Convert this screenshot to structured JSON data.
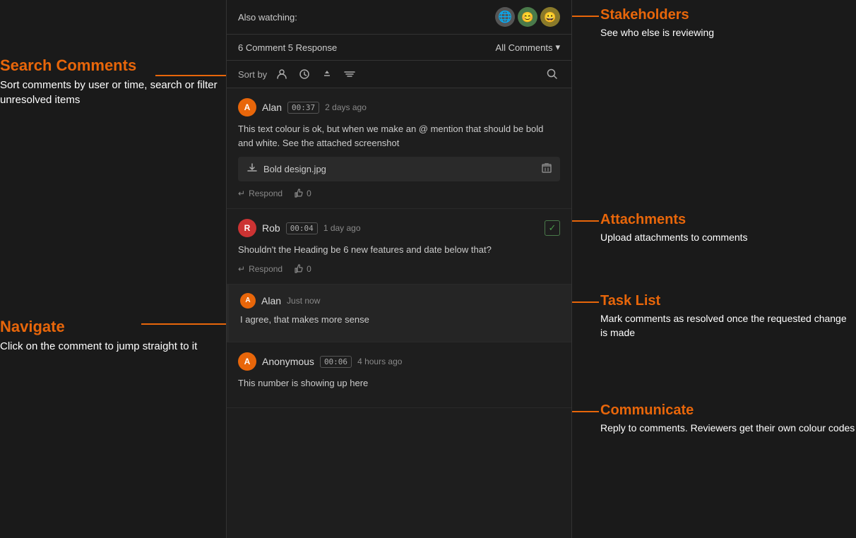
{
  "header": {
    "also_watching_label": "Also watching:",
    "comment_count_label": "6 Comment 5 Response",
    "filter_label": "All Comments",
    "sort_label": "Sort by"
  },
  "left_annotations": {
    "search_title": "Search Comments",
    "search_desc": "Sort comments by user or time, search or filter unresolved items",
    "navigate_title": "Navigate",
    "navigate_desc": "Click on the comment to jump straight to it"
  },
  "right_annotations": {
    "stakeholders_title": "Stakeholders",
    "stakeholders_desc": "See who else is reviewing",
    "attachments_title": "Attachments",
    "attachments_desc": "Upload attachments to comments",
    "tasklist_title": "Task List",
    "tasklist_desc": "Mark comments as resolved once the requested change is made",
    "communicate_title": "Communicate",
    "communicate_desc": "Reply to comments. Reviewers get their own colour codes"
  },
  "comments": [
    {
      "id": "comment-1",
      "avatar_letter": "A",
      "avatar_color": "orange",
      "username": "Alan",
      "timestamp": "00:37",
      "time_ago": "2 days ago",
      "text": "This text colour is ok, but when we make an @ mention that should be bold and white. See the attached screenshot",
      "attachment": "Bold design.jpg",
      "likes": "0",
      "has_resolve": false
    },
    {
      "id": "comment-2",
      "avatar_letter": "R",
      "avatar_color": "red",
      "username": "Rob",
      "timestamp": "00:04",
      "time_ago": "1 day ago",
      "text": "Shouldn't the Heading be 6 new features and date below that?",
      "attachment": null,
      "likes": "0",
      "has_resolve": true
    }
  ],
  "replies": [
    {
      "id": "reply-1",
      "avatar_letter": "A",
      "avatar_color": "orange",
      "username": "Alan",
      "time_ago": "Just now",
      "text": "I agree, that makes more sense"
    }
  ],
  "anon_comment": {
    "avatar_letter": "A",
    "avatar_color": "orange",
    "username": "Anonymous",
    "timestamp": "00:06",
    "time_ago": "4 hours ago",
    "text": "This number is showing up here"
  },
  "icons": {
    "respond": "↵",
    "like": "👍",
    "search": "🔍",
    "download": "⬇",
    "trash": "🗑",
    "chevron": "▾",
    "check": "✓",
    "user_sort": "👤",
    "time_sort": "🕐",
    "minus": "—"
  }
}
